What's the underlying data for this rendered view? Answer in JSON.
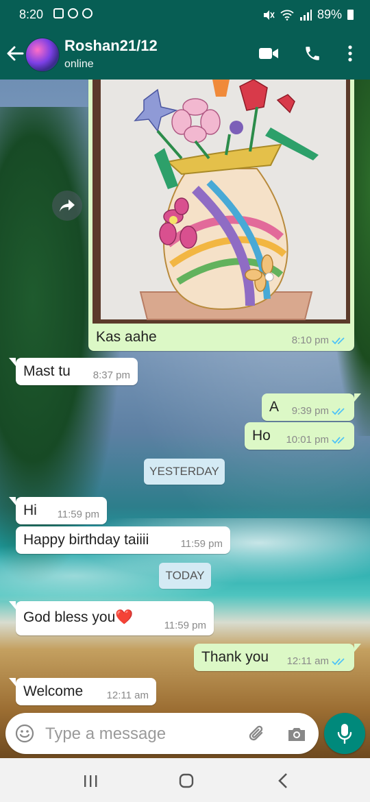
{
  "status_bar": {
    "time": "8:20",
    "battery": "89%"
  },
  "header": {
    "contact_name": "Roshan21/12",
    "contact_status": "online"
  },
  "image_message": {
    "caption": "Kas aahe",
    "time": "8:10 pm"
  },
  "messages": [
    {
      "text": "Mast tu",
      "time": "8:37 pm",
      "direction": "in"
    },
    {
      "text": "A",
      "time": "9:39 pm",
      "direction": "out"
    },
    {
      "text": "Ho",
      "time": "10:01 pm",
      "direction": "out"
    },
    {
      "text": "Hi",
      "time": "11:59 pm",
      "direction": "in"
    },
    {
      "text": "Happy birthday taiiii",
      "time": "11:59 pm",
      "direction": "in"
    },
    {
      "text": "God bless you❤️",
      "time": "11:59 pm",
      "direction": "in"
    },
    {
      "text": "Thank you",
      "time": "12:11 am",
      "direction": "out"
    },
    {
      "text": "Welcome",
      "time": "12:11 am",
      "direction": "in"
    }
  ],
  "date_chips": {
    "yesterday": "YESTERDAY",
    "today": "TODAY"
  },
  "input": {
    "placeholder": "Type a message",
    "value": ""
  },
  "colors": {
    "header": "#075e54",
    "outgoing_bubble": "#dcf8c6",
    "incoming_bubble": "#ffffff",
    "read_ticks": "#4fc3f7",
    "mic_button": "#00897b"
  }
}
